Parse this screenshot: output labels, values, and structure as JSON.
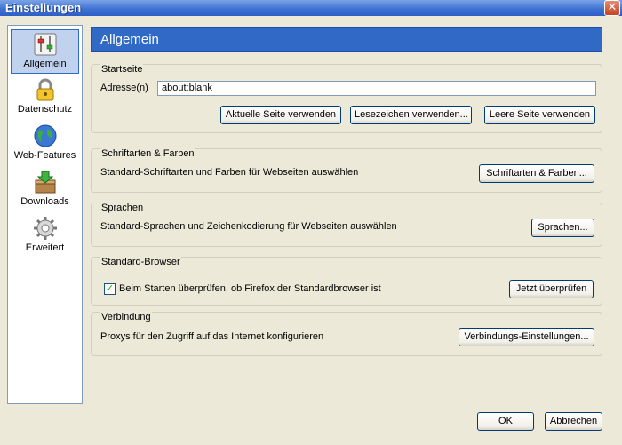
{
  "window": {
    "title": "Einstellungen",
    "close_glyph": "✕"
  },
  "sidebar": {
    "items": [
      {
        "label": "Allgemein",
        "icon": "general-icon",
        "selected": true
      },
      {
        "label": "Datenschutz",
        "icon": "lock-icon",
        "selected": false
      },
      {
        "label": "Web-Features",
        "icon": "globe-icon",
        "selected": false
      },
      {
        "label": "Downloads",
        "icon": "download-icon",
        "selected": false
      },
      {
        "label": "Erweitert",
        "icon": "gear-icon",
        "selected": false
      }
    ]
  },
  "main": {
    "header": "Allgemein",
    "startseite": {
      "title": "Startseite",
      "address_label": "Adresse(n)",
      "address_value": "about:blank",
      "btn_current": "Aktuelle Seite verwenden",
      "btn_bookmark": "Lesezeichen verwenden...",
      "btn_blank": "Leere Seite verwenden"
    },
    "fonts": {
      "title": "Schriftarten & Farben",
      "description": "Standard-Schriftarten und Farben für Webseiten auswählen",
      "button": "Schriftarten & Farben..."
    },
    "languages": {
      "title": "Sprachen",
      "description": "Standard-Sprachen und Zeichenkodierung für Webseiten auswählen",
      "button": "Sprachen..."
    },
    "default_browser": {
      "title": "Standard-Browser",
      "checkbox_label": "Beim Starten überprüfen, ob Firefox der Standardbrowser ist",
      "checked": true,
      "button": "Jetzt überprüfen"
    },
    "connection": {
      "title": "Verbindung",
      "description": "Proxys für den Zugriff auf das Internet konfigurieren",
      "button": "Verbindungs-Einstellungen..."
    }
  },
  "footer": {
    "ok": "OK",
    "cancel": "Abbrechen"
  },
  "colors": {
    "header_bg": "#3169c6",
    "dialog_bg": "#ece9d8",
    "titlebar": "#3c6fd3"
  }
}
